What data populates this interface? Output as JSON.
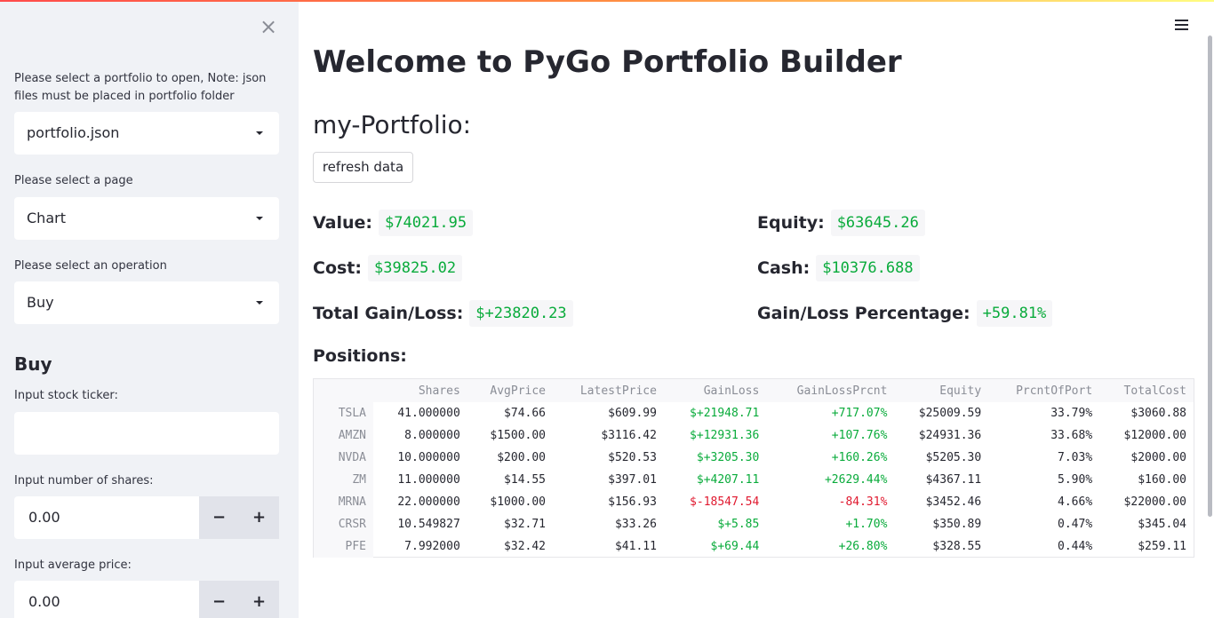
{
  "sidebar": {
    "portfolio_label": "Please select a portfolio to open, Note: json files must be placed in portfolio folder",
    "portfolio_value": "portfolio.json",
    "page_label": "Please select a page",
    "page_value": "Chart",
    "operation_label": "Please select an operation",
    "operation_value": "Buy",
    "section_heading": "Buy",
    "ticker_label": "Input stock ticker:",
    "ticker_value": "",
    "shares_label": "Input number of shares:",
    "shares_value": "0.00",
    "avg_price_label": "Input average price:",
    "avg_price_value": "0.00",
    "minus": "−",
    "plus": "+",
    "close": "×"
  },
  "main": {
    "title": "Welcome to PyGo Portfolio Builder",
    "portfolio_name": "my-Portfolio:",
    "refresh_label": "refresh data",
    "metrics": {
      "value_label": "Value:",
      "value": "$74021.95",
      "equity_label": "Equity:",
      "equity": "$63645.26",
      "cost_label": "Cost:",
      "cost": "$39825.02",
      "cash_label": "Cash:",
      "cash": "$10376.688",
      "gain_label": "Total Gain/Loss:",
      "gain": "$+23820.23",
      "gain_pct_label": "Gain/Loss Percentage:",
      "gain_pct": "+59.81%"
    },
    "positions_heading": "Positions:",
    "table": {
      "columns": [
        "Shares",
        "AvgPrice",
        "LatestPrice",
        "GainLoss",
        "GainLossPrcnt",
        "Equity",
        "PrcntOfPort",
        "TotalCost"
      ],
      "rows": [
        {
          "ticker": "TSLA",
          "cells": [
            "41.000000",
            "$74.66",
            "$609.99",
            "$+21948.71",
            "+717.07%",
            "$25009.59",
            "33.79%",
            "$3060.88"
          ]
        },
        {
          "ticker": "AMZN",
          "cells": [
            "8.000000",
            "$1500.00",
            "$3116.42",
            "$+12931.36",
            "+107.76%",
            "$24931.36",
            "33.68%",
            "$12000.00"
          ]
        },
        {
          "ticker": "NVDA",
          "cells": [
            "10.000000",
            "$200.00",
            "$520.53",
            "$+3205.30",
            "+160.26%",
            "$5205.30",
            "7.03%",
            "$2000.00"
          ]
        },
        {
          "ticker": "ZM",
          "cells": [
            "11.000000",
            "$14.55",
            "$397.01",
            "$+4207.11",
            "+2629.44%",
            "$4367.11",
            "5.90%",
            "$160.00"
          ]
        },
        {
          "ticker": "MRNA",
          "cells": [
            "22.000000",
            "$1000.00",
            "$156.93",
            "$-18547.54",
            "-84.31%",
            "$3452.46",
            "4.66%",
            "$22000.00"
          ]
        },
        {
          "ticker": "CRSR",
          "cells": [
            "10.549827",
            "$32.71",
            "$33.26",
            "$+5.85",
            "+1.70%",
            "$350.89",
            "0.47%",
            "$345.04"
          ]
        },
        {
          "ticker": "PFE",
          "cells": [
            "7.992000",
            "$32.42",
            "$41.11",
            "$+69.44",
            "+26.80%",
            "$328.55",
            "0.44%",
            "$259.11"
          ]
        }
      ]
    }
  },
  "colors": {
    "positive": "#09ab3b",
    "negative": "#e0192f",
    "accent": "#ff4b4b"
  }
}
